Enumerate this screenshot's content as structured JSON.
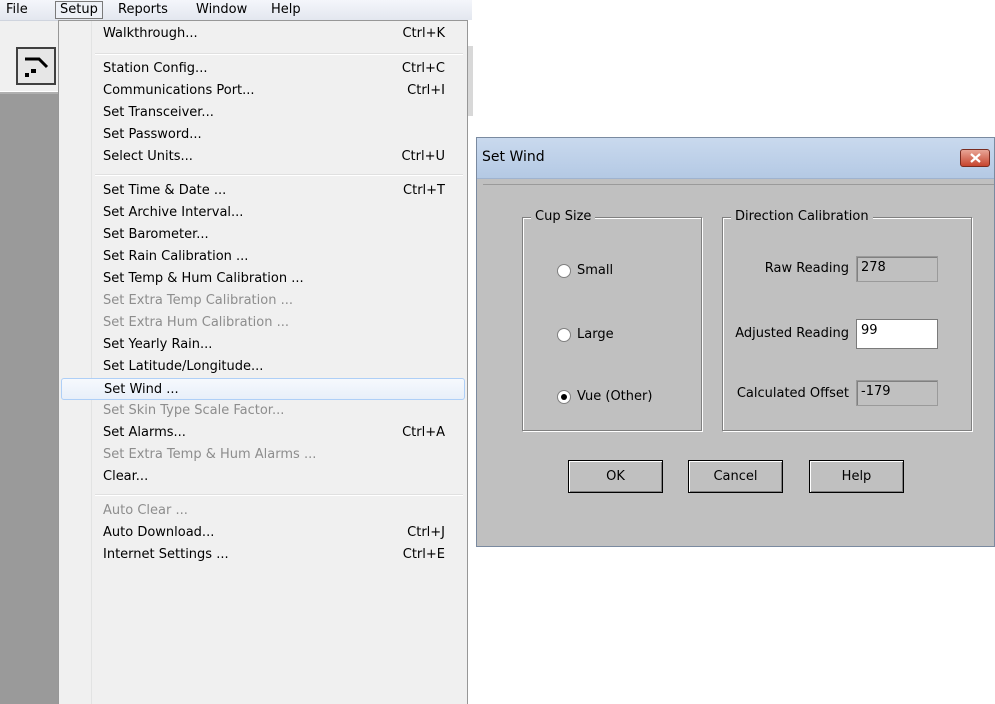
{
  "menubar": {
    "items": [
      "File",
      "Setup",
      "Reports",
      "Window",
      "Help"
    ],
    "active": "Setup"
  },
  "setup_menu": {
    "items": [
      {
        "label": "Walkthrough...",
        "shortcut": "Ctrl+K",
        "disabled": false
      },
      {
        "label": "Station Config...",
        "shortcut": "Ctrl+C",
        "disabled": false
      },
      {
        "label": "Communications Port...",
        "shortcut": "Ctrl+I",
        "disabled": false
      },
      {
        "label": "Set Transceiver...",
        "shortcut": "",
        "disabled": false
      },
      {
        "label": "Set Password...",
        "shortcut": "",
        "disabled": false
      },
      {
        "label": "Select Units...",
        "shortcut": "Ctrl+U",
        "disabled": false
      },
      {
        "label": "Set Time & Date ...",
        "shortcut": "Ctrl+T",
        "disabled": false
      },
      {
        "label": "Set Archive Interval...",
        "shortcut": "",
        "disabled": false
      },
      {
        "label": "Set Barometer...",
        "shortcut": "",
        "disabled": false
      },
      {
        "label": "Set Rain Calibration ...",
        "shortcut": "",
        "disabled": false
      },
      {
        "label": "Set Temp & Hum Calibration ...",
        "shortcut": "",
        "disabled": false
      },
      {
        "label": "Set Extra Temp Calibration ...",
        "shortcut": "",
        "disabled": true
      },
      {
        "label": "Set Extra Hum Calibration ...",
        "shortcut": "",
        "disabled": true
      },
      {
        "label": "Set Yearly Rain...",
        "shortcut": "",
        "disabled": false
      },
      {
        "label": "Set Latitude/Longitude...",
        "shortcut": "",
        "disabled": false
      },
      {
        "label": "Set Wind ...",
        "shortcut": "",
        "disabled": false
      },
      {
        "label": "Set Skin Type Scale Factor...",
        "shortcut": "",
        "disabled": true
      },
      {
        "label": "Set Alarms...",
        "shortcut": "Ctrl+A",
        "disabled": false
      },
      {
        "label": "Set Extra Temp & Hum Alarms ...",
        "shortcut": "",
        "disabled": true
      },
      {
        "label": "Clear...",
        "shortcut": "",
        "disabled": false
      },
      {
        "label": "Auto Clear ...",
        "shortcut": "",
        "disabled": true
      },
      {
        "label": "Auto Download...",
        "shortcut": "Ctrl+J",
        "disabled": false
      },
      {
        "label": "Internet Settings ...",
        "shortcut": "Ctrl+E",
        "disabled": false
      }
    ],
    "highlighted": "Set Wind ..."
  },
  "dialog": {
    "title": "Set Wind",
    "cup_size": {
      "legend": "Cup Size",
      "options": [
        "Small",
        "Large",
        "Vue (Other)"
      ],
      "selected": "Vue (Other)"
    },
    "direction_calibration": {
      "legend": "Direction Calibration",
      "raw_label": "Raw Reading",
      "raw_value": "278",
      "adjusted_label": "Adjusted Reading",
      "adjusted_value": "99",
      "offset_label": "Calculated Offset",
      "offset_value": "-179"
    },
    "buttons": {
      "ok": "OK",
      "cancel": "Cancel",
      "help": "Help"
    }
  }
}
